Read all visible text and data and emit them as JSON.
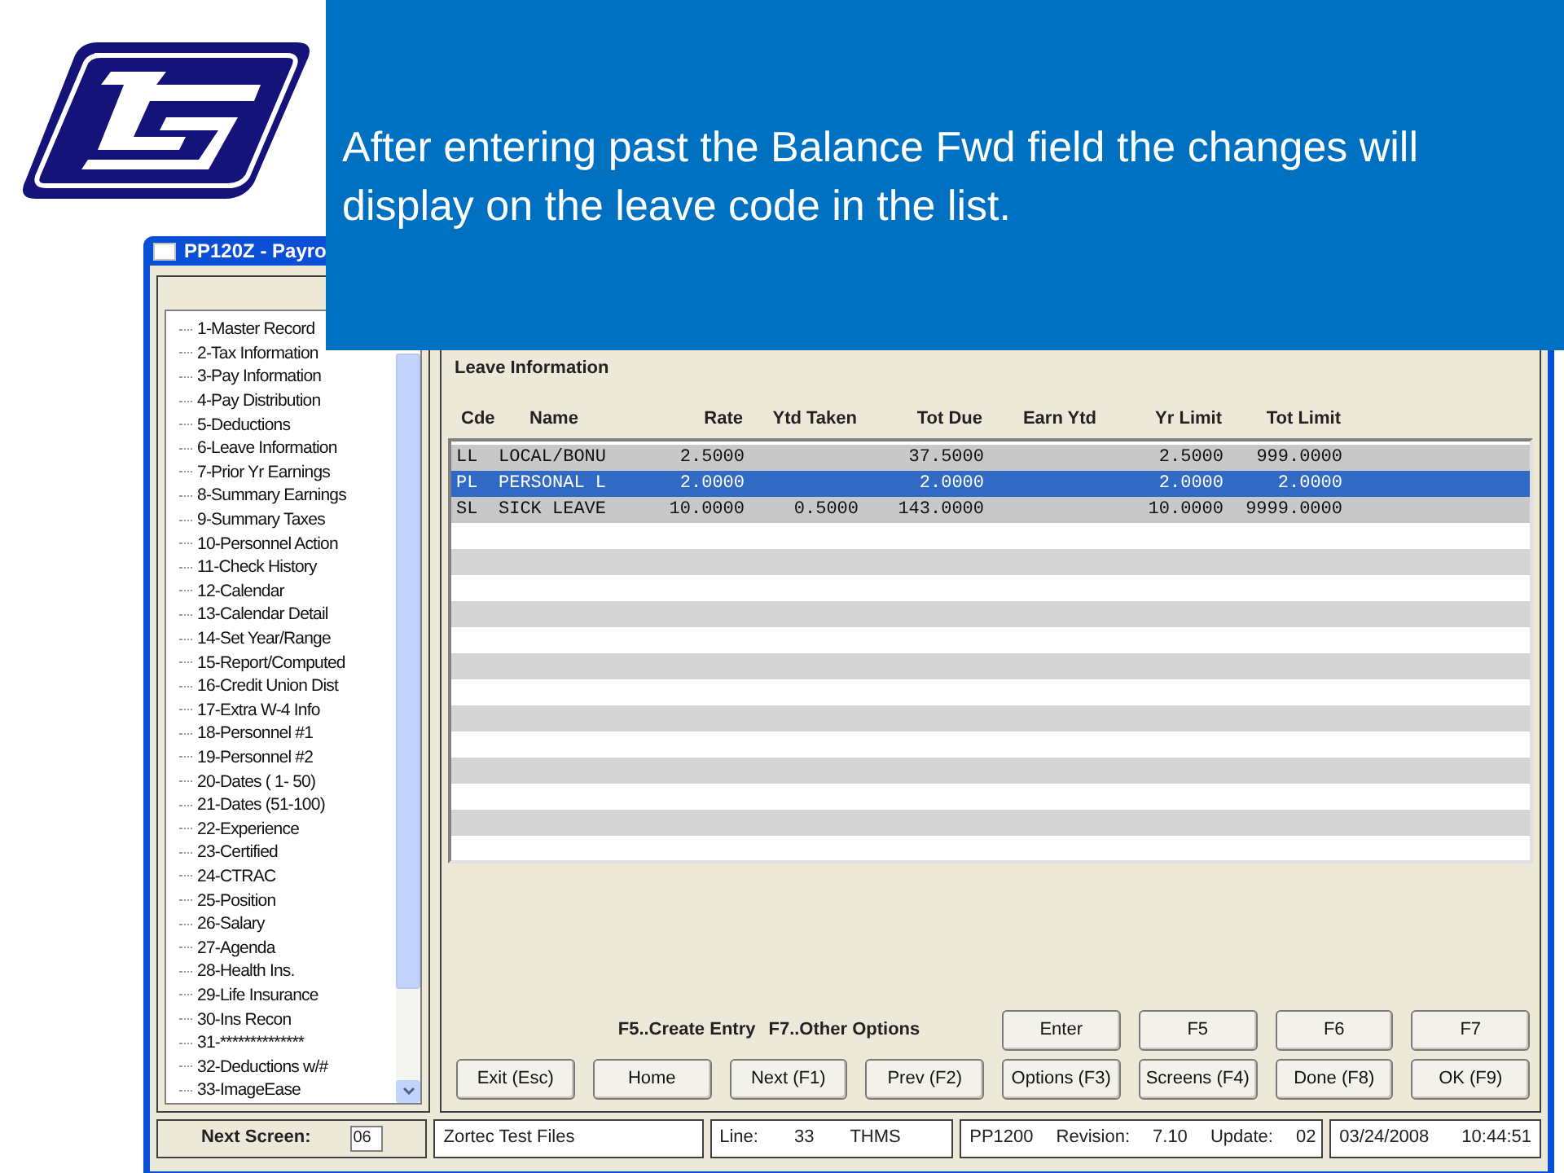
{
  "slide": {
    "caption": "After entering past the Balance Fwd field the changes will display on the leave code in the list."
  },
  "window": {
    "title": "PP120Z - Payro"
  },
  "navigation": {
    "items": [
      "1-Master Record",
      "2-Tax Information",
      "3-Pay Information",
      "4-Pay Distribution",
      "5-Deductions",
      "6-Leave Information",
      "7-Prior Yr Earnings",
      "8-Summary Earnings",
      "9-Summary Taxes",
      "10-Personnel Action",
      "11-Check History",
      "12-Calendar",
      "13-Calendar Detail",
      "14-Set Year/Range",
      "15-Report/Computed",
      "16-Credit Union Dist",
      "17-Extra W-4 Info",
      "18-Personnel #1",
      "19-Personnel #2",
      "20-Dates ( 1- 50)",
      "21-Dates (51-100)",
      "22-Experience",
      "23-Certified",
      "24-CTRAC",
      "25-Position",
      "26-Salary",
      "27-Agenda",
      "28-Health Ins.",
      "29-Life Insurance",
      "30-Ins Recon",
      "31-**************",
      "32-Deductions w/#",
      "33-ImageEase"
    ]
  },
  "panel": {
    "title": "Leave Information",
    "columns": [
      "Cde",
      "Name",
      "Rate",
      "Ytd Taken",
      "Tot Due",
      "Earn Ytd",
      "Yr Limit",
      "Tot Limit"
    ],
    "rows": [
      {
        "cells": [
          "LL",
          "LOCAL/BONU",
          "2.5000",
          "",
          "37.5000",
          "",
          "2.5000",
          "999.0000"
        ],
        "selected": false
      },
      {
        "cells": [
          "PL",
          "PERSONAL L",
          "2.0000",
          "",
          "2.0000",
          "",
          "2.0000",
          "2.0000"
        ],
        "selected": true
      },
      {
        "cells": [
          "SL",
          "SICK LEAVE",
          "10.0000",
          "0.5000",
          "143.0000",
          "",
          "10.0000",
          "9999.0000"
        ],
        "selected": false
      }
    ]
  },
  "hints": [
    "F5..Create Entry",
    "F7..Other Options"
  ],
  "button_rows": [
    {
      "buttons": [
        "Enter",
        "F5",
        "F6",
        "F7"
      ]
    },
    {
      "buttons": [
        "Exit (Esc)",
        "Home",
        "Next (F1)",
        "Prev (F2)",
        "Options (F3)",
        "Screens (F4)",
        "Done (F8)",
        "OK (F9)"
      ]
    }
  ],
  "status_bar": {
    "next_screen_label": "Next Screen:",
    "next_screen_value": "06",
    "sections": [
      [
        "Zortec Test Files"
      ],
      [
        "Line:",
        "33",
        "THMS"
      ],
      [
        "PP1200",
        "Revision:",
        "7.10",
        "Update:",
        "02"
      ],
      [
        "03/24/2008",
        "10:44:51"
      ]
    ]
  }
}
